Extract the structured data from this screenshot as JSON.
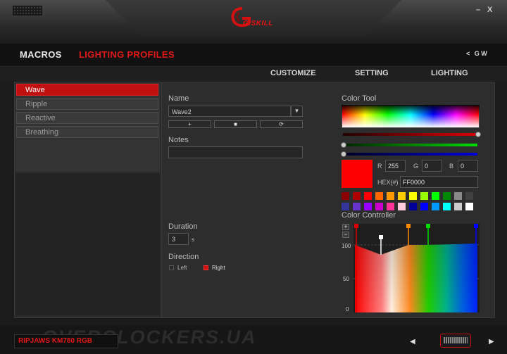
{
  "window": {
    "minimize_label": "–",
    "close_label": "X"
  },
  "brand": {
    "name": "G.SKILL"
  },
  "nav": {
    "macros": "MACROS",
    "lighting_profiles": "LIGHTING PROFILES",
    "tools": "G W"
  },
  "subnav": {
    "customize": "CUSTOMIZE",
    "setting": "SETTING",
    "lighting": "LIGHTING"
  },
  "profiles": [
    "Wave",
    "Ripple",
    "Reactive",
    "Breathing"
  ],
  "profile_active_index": 0,
  "editor": {
    "name_label": "Name",
    "name_value": "Wave2",
    "add_symbol": "+",
    "delete_symbol": "■",
    "reset_symbol": "⟳",
    "notes_label": "Notes",
    "notes_value": "",
    "duration_label": "Duration",
    "duration_value": "3",
    "duration_unit": "s",
    "direction_label": "Direction",
    "direction_left": "Left",
    "direction_right": "Right",
    "direction_selected": "Right"
  },
  "color_tool": {
    "label": "Color Tool",
    "r_label": "R",
    "r_value": "255",
    "g_label": "G",
    "g_value": "0",
    "b_label": "B",
    "b_value": "0",
    "hex_label": "HEX(#)",
    "hex_value": "FF0000",
    "current_color": "#ff0000",
    "slider_levels": {
      "red": 1.0,
      "green": 0.0,
      "blue": 0.0
    },
    "presets": [
      "#8b0000",
      "#b00000",
      "#ff0000",
      "#ff6600",
      "#ff9900",
      "#ffcc00",
      "#ffff00",
      "#99ff00",
      "#00ff00",
      "#008800",
      "#888888",
      "#404040",
      "#333399",
      "#6633cc",
      "#9900ff",
      "#cc00cc",
      "#ff3399",
      "#ffccdd",
      "#000099",
      "#0000ff",
      "#0099ff",
      "#00ffff",
      "#cccccc",
      "#ffffff"
    ]
  },
  "color_controller": {
    "label": "Color Controller",
    "zoom_in": "+",
    "zoom_out": "−",
    "y_ticks": [
      "100",
      "50",
      "0"
    ]
  },
  "footer": {
    "device": "RIPJAWS KM780 RGB",
    "watermark": "OVERCLOCKERS.UA",
    "prev": "◀",
    "next": "▶"
  }
}
